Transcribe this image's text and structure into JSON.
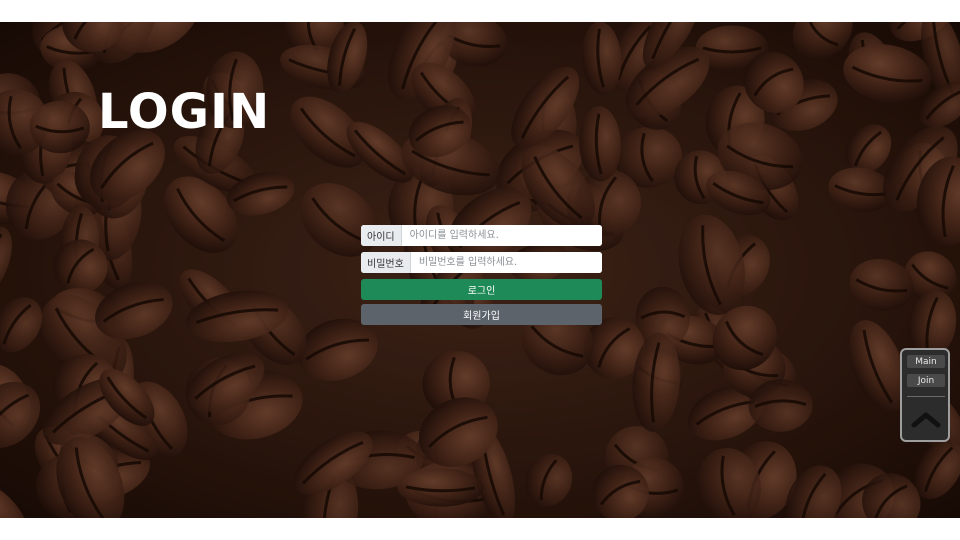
{
  "hero": {
    "title": "LOGIN"
  },
  "login_form": {
    "id_label": "아이디",
    "id_placeholder": "아이디를 입력하세요.",
    "pw_label": "비밀번호",
    "pw_placeholder": "비밀번호를 입력하세요.",
    "login_button": "로그인",
    "signup_button": "회원가입"
  },
  "quick_menu": {
    "main_link": "Main",
    "join_link": "Join",
    "top_icon": "chevron-up-icon"
  },
  "colors": {
    "login_button": "#1e8a58",
    "signup_button": "#5d636b",
    "background": "#2c160c"
  }
}
